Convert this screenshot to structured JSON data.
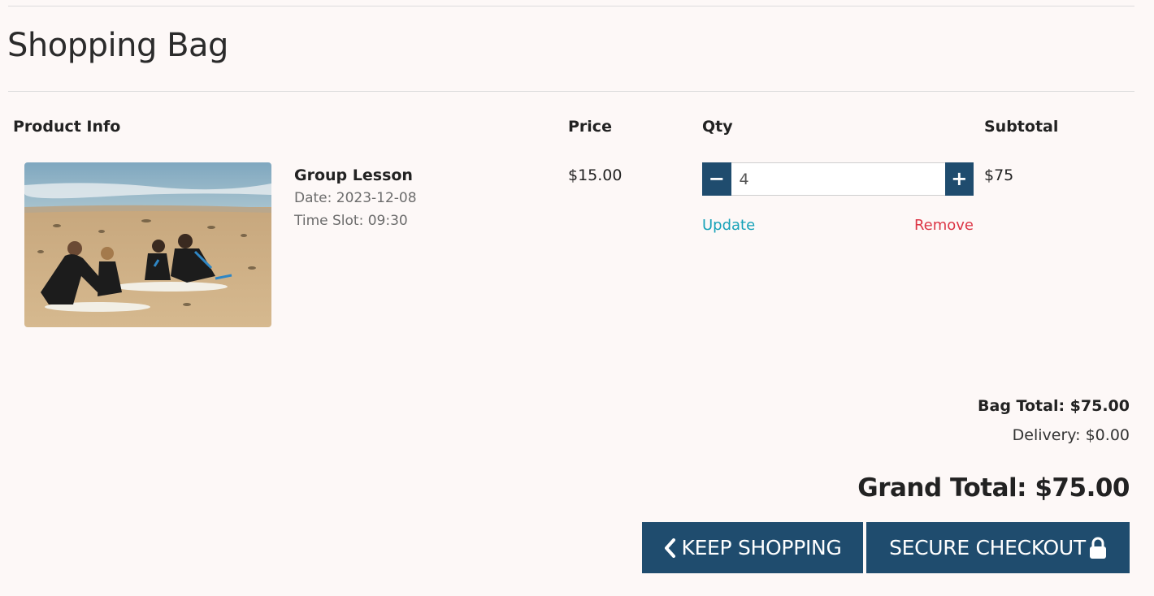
{
  "page": {
    "title": "Shopping Bag"
  },
  "table": {
    "headers": {
      "product_info": "Product Info",
      "price": "Price",
      "qty": "Qty",
      "subtotal": "Subtotal"
    }
  },
  "items": [
    {
      "name": "Group Lesson",
      "date": "Date: 2023-12-08",
      "time_slot": "Time Slot: 09:30",
      "price": "$15.00",
      "quantity": "4",
      "subtotal": "$75",
      "decrement_label": "−",
      "increment_label": "+",
      "update_label": "Update",
      "remove_label": "Remove"
    }
  ],
  "totals": {
    "bag_total": "Bag Total: $75.00",
    "delivery": "Delivery: $0.00",
    "grand_total": "Grand Total: $75.00"
  },
  "actions": {
    "keep_shopping": "KEEP SHOPPING",
    "keep_shopping_icon": "chevron-left-icon",
    "secure_checkout": "SECURE CHECKOUT",
    "secure_checkout_icon": "lock-icon"
  },
  "colors": {
    "primary": "#1f4c6e",
    "update_link": "#17a2b8",
    "remove_link": "#dc3545",
    "background": "#fdf8f7"
  }
}
